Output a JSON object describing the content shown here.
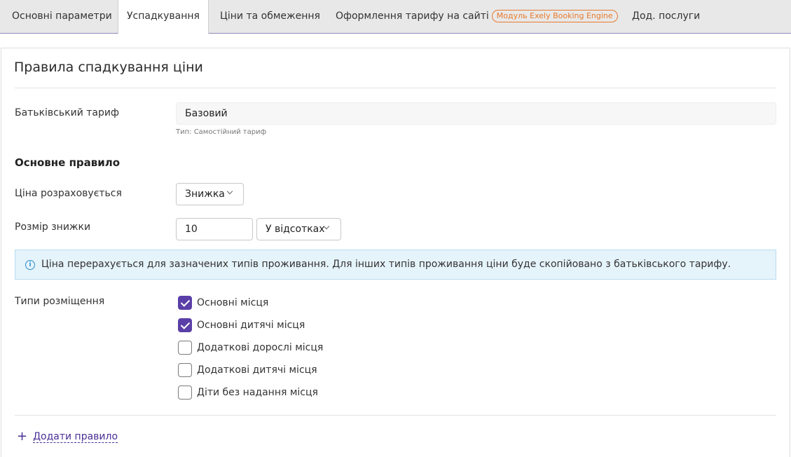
{
  "tabs": [
    {
      "label": "Основні параметри"
    },
    {
      "label": "Успадкування"
    },
    {
      "label": "Ціни та обмеження"
    },
    {
      "label": "Оформлення тарифу на сайті",
      "badge": "Модуль Exely Booking Engine"
    },
    {
      "label": "Дод. послуги"
    }
  ],
  "active_tab": "Успадкування",
  "page_title": "Правила спадкування ціни",
  "parent_tariff": {
    "label": "Батьківський тариф",
    "value": "Базовий",
    "hint": "Тип: Самостійний тариф"
  },
  "main_rule": {
    "heading": "Основне правило",
    "price_calc": {
      "label": "Ціна розраховується",
      "value": "Знижка"
    },
    "discount": {
      "label": "Розмір знижки",
      "value": "10",
      "unit": "У відсотках"
    }
  },
  "info_message": "Ціна перерахується для зазначених типів проживання. Для інших типів проживання ціни буде скопійовано з батьківського тарифу.",
  "accommodation": {
    "label": "Типи розміщення",
    "options": [
      {
        "label": "Основні місця",
        "checked": true
      },
      {
        "label": "Основні дитячі місця",
        "checked": true
      },
      {
        "label": "Додаткові дорослі місця",
        "checked": false
      },
      {
        "label": "Додаткові дитячі місця",
        "checked": false
      },
      {
        "label": "Діти без надання місця",
        "checked": false
      }
    ]
  },
  "add_rule": "Додати правило",
  "colors": {
    "accent": "#5b3fa8",
    "badge": "#e87a2c",
    "info_bg": "#e5f3fb",
    "info_icon": "#2d8fd0"
  }
}
